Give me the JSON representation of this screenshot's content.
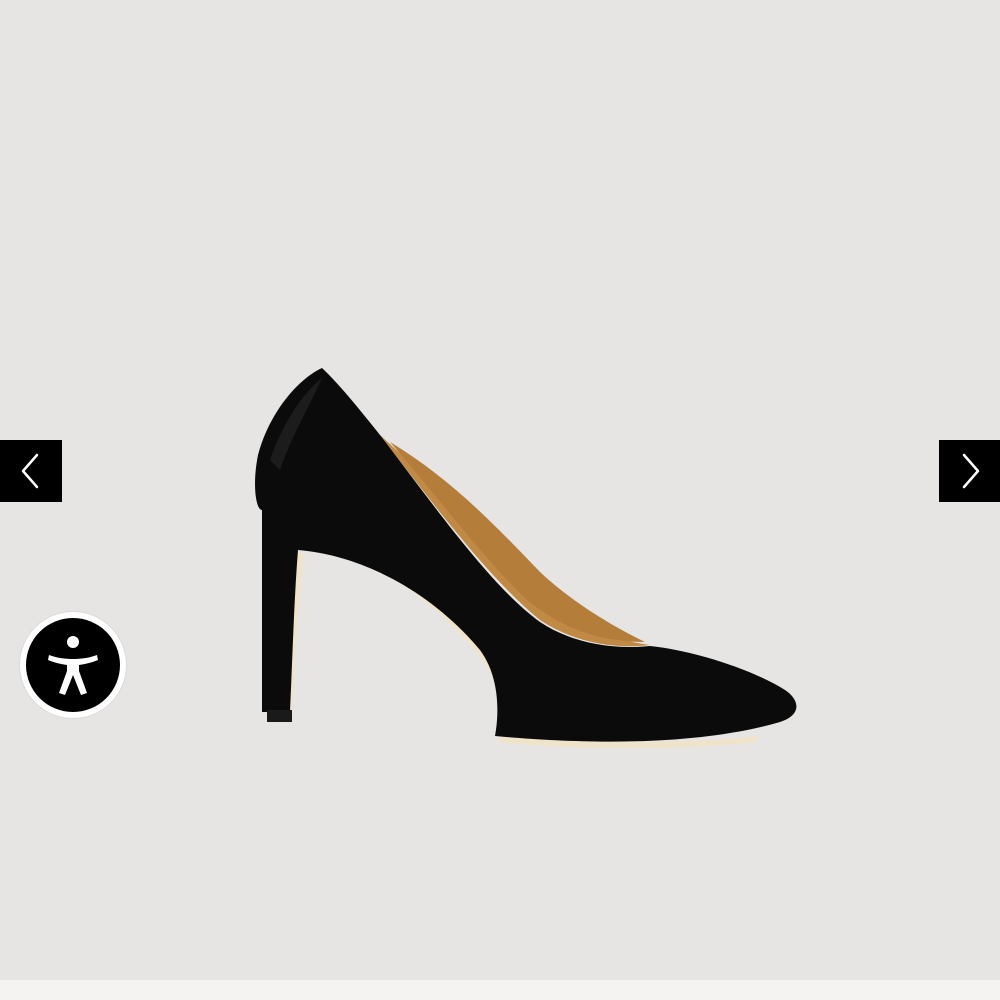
{
  "gallery": {
    "background_color": "#e7e5e4",
    "image": {
      "subject_icon": "high-heel-pump-icon",
      "upper_color": "#0b0b0b",
      "lining_color": "#c08a45",
      "sole_color": "#efe3c9"
    },
    "prev_button": {
      "icon": "chevron-left-icon",
      "color": "#000000"
    },
    "next_button": {
      "icon": "chevron-right-icon",
      "color": "#000000"
    }
  },
  "accessibility_widget": {
    "icon": "accessibility-person-icon",
    "ring_color": "#ffffff",
    "fill_color": "#000000"
  }
}
